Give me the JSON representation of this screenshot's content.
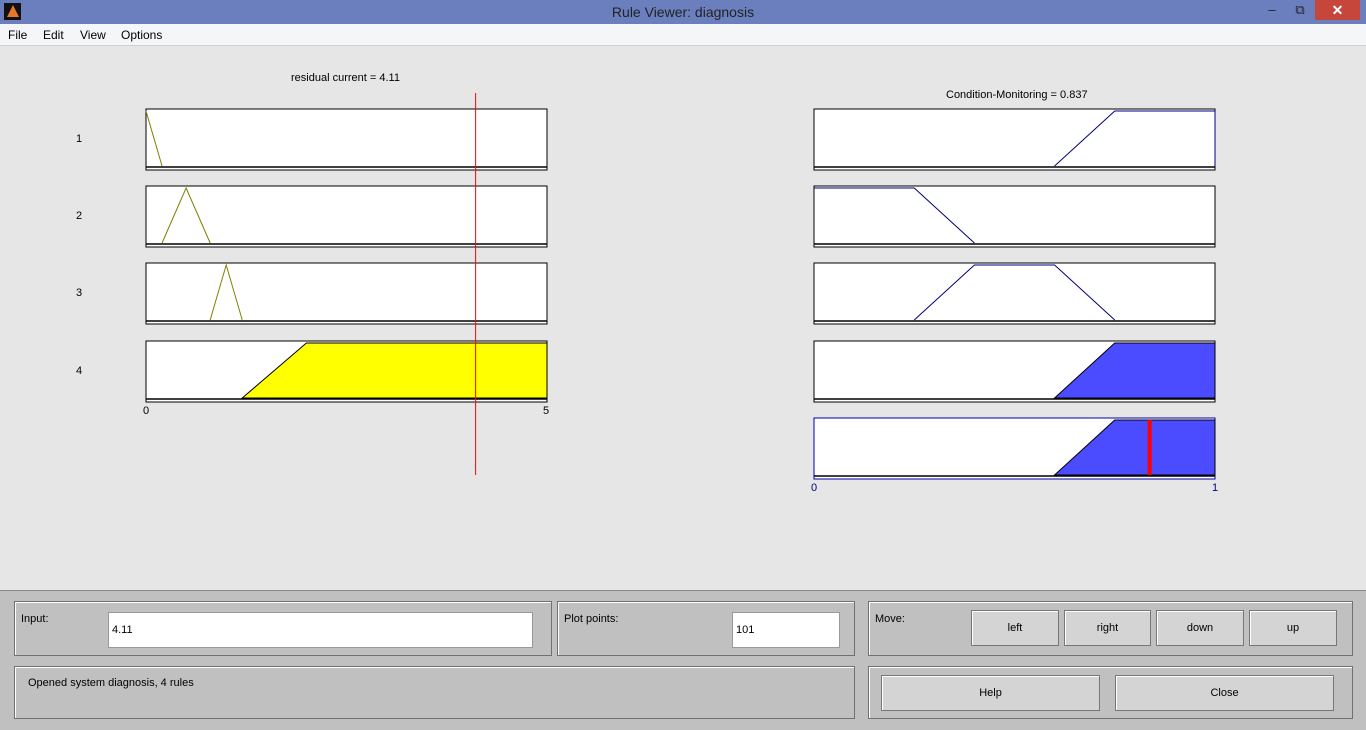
{
  "window": {
    "title": "Rule Viewer: diagnosis",
    "controls": [
      "minimize",
      "restore",
      "close"
    ]
  },
  "menu": [
    "File",
    "Edit",
    "View",
    "Options"
  ],
  "input_plot": {
    "label": "residual current = 4.11",
    "variable": "residual current",
    "value": 4.11,
    "range": [
      0,
      5
    ],
    "tick_labels": [
      "0",
      "5"
    ],
    "line_color": "#ff0000",
    "fill_color": "#ffff00",
    "line_mf_color": "#808000",
    "rules": [
      {
        "number": "1",
        "mf": [
          0,
          0,
          0.2
        ],
        "fired": false
      },
      {
        "number": "2",
        "mf": [
          0.2,
          0.5,
          0.8
        ],
        "fired": false
      },
      {
        "number": "3",
        "mf": [
          0.8,
          1.0,
          1.2
        ],
        "fired": false
      },
      {
        "number": "4",
        "mf": [
          1.2,
          2.0,
          5,
          5
        ],
        "fired": true
      }
    ]
  },
  "output_plot": {
    "label": "Condition-Monitoring = 0.837",
    "variable": "Condition-Monitoring",
    "value": 0.837,
    "range": [
      0,
      1
    ],
    "tick_labels": [
      "0",
      "1"
    ],
    "fill_color": "#4b4bff",
    "line_color": "#000080",
    "marker_color": "#ff0000",
    "rules": [
      {
        "mf": [
          0.6,
          0.75,
          1,
          1
        ],
        "fired": false
      },
      {
        "mf": [
          0,
          0,
          0.25,
          0.4
        ],
        "fired": false
      },
      {
        "mf": [
          0.25,
          0.4,
          0.6,
          0.75
        ],
        "fired": false
      },
      {
        "mf": [
          0.6,
          0.75,
          1,
          1
        ],
        "fired": true
      }
    ],
    "aggregate": {
      "mf": [
        0.6,
        0.75,
        1,
        1
      ]
    }
  },
  "controls": {
    "input_label": "Input:",
    "input_value": "4.11",
    "plot_points_label": "Plot points:",
    "plot_points_value": "101",
    "move_label": "Move:",
    "move_buttons": [
      "left",
      "right",
      "down",
      "up"
    ],
    "status": "Opened system diagnosis, 4 rules",
    "help": "Help",
    "close": "Close"
  }
}
